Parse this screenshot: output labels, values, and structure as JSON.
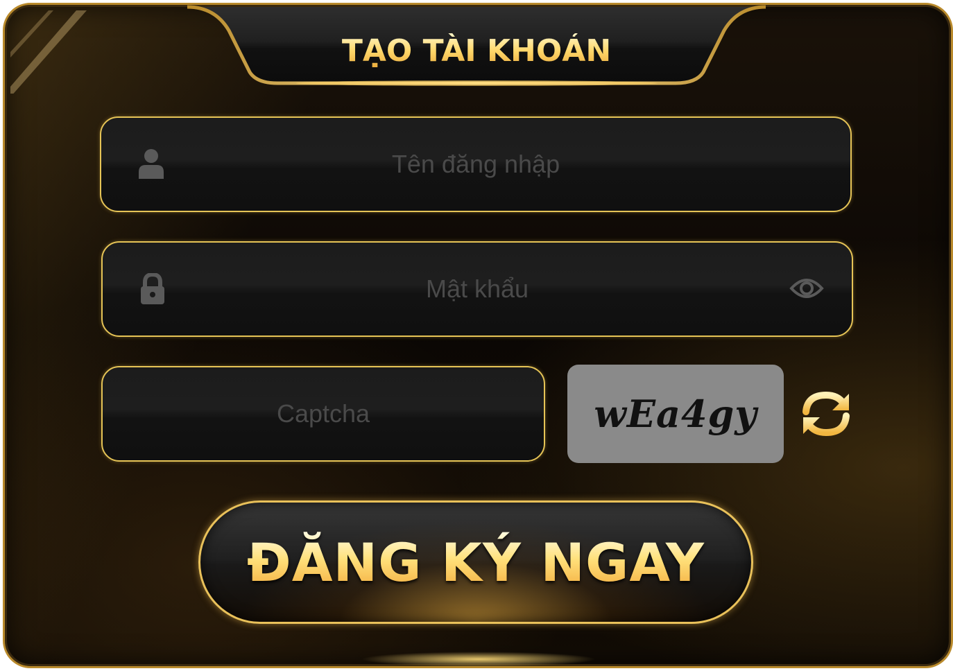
{
  "header": {
    "title": "TẠO TÀI KHOẢN"
  },
  "form": {
    "username": {
      "placeholder": "Tên đăng nhập",
      "value": "",
      "icon": "user-icon"
    },
    "password": {
      "placeholder": "Mật khẩu",
      "value": "",
      "icon": "lock-icon",
      "toggle_icon": "eye-icon"
    },
    "captcha": {
      "placeholder": "Captcha",
      "value": "",
      "code": "wEa4gy",
      "refresh_icon": "refresh-icon"
    }
  },
  "submit": {
    "label": "ĐĂNG KÝ NGAY"
  },
  "colors": {
    "accent_gold": "#e6c456",
    "title_gold": "#ffd978",
    "panel_bg": "#0b0704",
    "field_bg": "#1a1a1a",
    "captcha_bg": "#8a8a8a"
  }
}
